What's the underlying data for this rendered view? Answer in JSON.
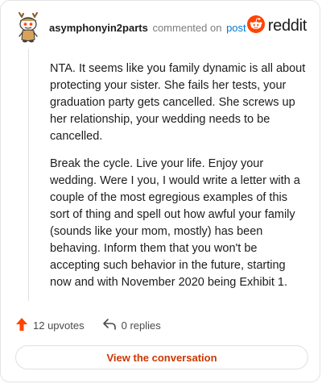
{
  "header": {
    "username": "asymphonyin2parts",
    "commented_text": "commented on",
    "post_link": "post",
    "brand_wordmark": "reddit",
    "avatar_icon": "snoo-avatar-icon",
    "brand_icon": "reddit-alien-icon"
  },
  "comment": {
    "paragraphs": [
      "NTA. It seems like you family dynamic is all about protecting your sister. She fails her tests, your graduation party gets cancelled. She screws up her relationship, your wedding needs to be cancelled.",
      "Break the cycle. Live your life. Enjoy your wedding. Were I you, I would write a letter with a couple of the most egregious examples of this sort of thing and spell out how awful your family (sounds like your mom, mostly) has been behaving. Inform them that you won't be accepting such behavior in the future, starting now and with November 2020 being Exhibit 1."
    ]
  },
  "actions": {
    "upvotes_label": "12 upvotes",
    "replies_label": "0 replies",
    "upvote_icon": "upvote-arrow-icon",
    "reply_icon": "reply-arrow-icon"
  },
  "cta": {
    "label": "View the conversation"
  },
  "colors": {
    "brand": "#ff4500",
    "link": "#0079d3",
    "cta_text": "#cc3700",
    "border": "#e3e3e3"
  }
}
